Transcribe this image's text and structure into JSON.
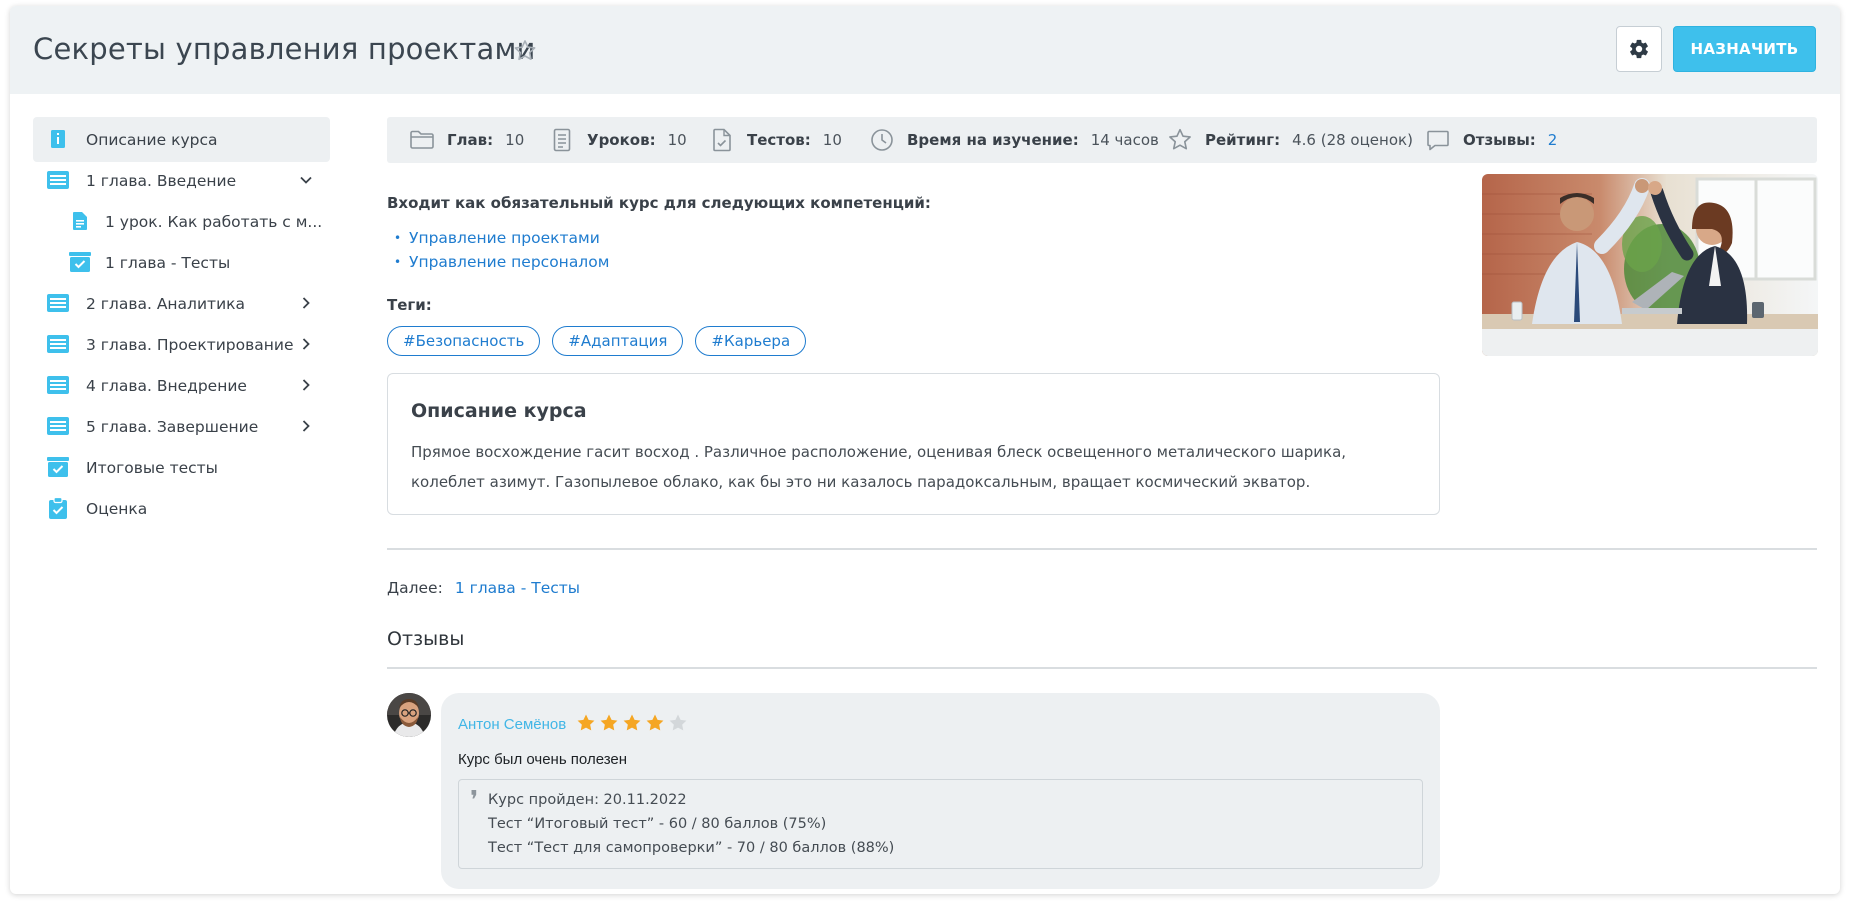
{
  "header": {
    "title": "Секреты управления проектами",
    "assign_label": "НАЗНАЧИТЬ"
  },
  "sidebar": {
    "items": [
      {
        "label": "Описание курса",
        "icon": "info-book-icon",
        "active": true
      },
      {
        "label": "1 глава. Введение",
        "icon": "chapter-icon",
        "expanded": true
      },
      {
        "label": "1 урок. Как работать с м...",
        "icon": "lesson-icon"
      },
      {
        "label": "1 глава - Тесты",
        "icon": "test-box-icon"
      },
      {
        "label": "2 глава. Аналитика",
        "icon": "chapter-icon"
      },
      {
        "label": "3 глава. Проектирование",
        "icon": "chapter-icon"
      },
      {
        "label": "4 глава. Внедрение",
        "icon": "chapter-icon"
      },
      {
        "label": "5 глава. Завершение",
        "icon": "chapter-icon"
      },
      {
        "label": "Итоговые тесты",
        "icon": "test-box-icon"
      },
      {
        "label": "Оценка",
        "icon": "clipboard-check-icon"
      }
    ]
  },
  "stats": {
    "chapters": {
      "label": "Глав:",
      "value": "10",
      "icon": "folder-icon"
    },
    "lessons": {
      "label": "Уроков:",
      "value": "10",
      "icon": "document-icon"
    },
    "tests": {
      "label": "Тестов:",
      "value": "10",
      "icon": "test-file-icon"
    },
    "time": {
      "label": "Время на изучение:",
      "value": "14 часов",
      "icon": "clock-icon"
    },
    "rating": {
      "label": "Рейтинг:",
      "value": "4.6 (28 оценок)",
      "icon": "star-outline-icon"
    },
    "reviews": {
      "label": "Отзывы:",
      "value": "2",
      "icon": "comment-icon"
    }
  },
  "competencies": {
    "title": "Входит как обязательный курс для следующих компетенций:",
    "items": [
      "Управление проектами",
      "Управление персоналом"
    ]
  },
  "tags": {
    "title": "Теги:",
    "items": [
      "#Безопасность",
      "#Адаптация",
      "#Карьера"
    ]
  },
  "description": {
    "title": "Описание курса",
    "text": "Прямое восхождение гасит восход . Различное расположение, оценивая блеск освещенного металического шарика, колеблет азимут. Газопылевое облако, как бы это ни казалось парадоксальным, вращает космический экватор."
  },
  "next": {
    "label": "Далее:",
    "link": "1 глава - Тесты"
  },
  "reviews_section": {
    "title": "Отзывы",
    "items": [
      {
        "author": "Антон Семёнов",
        "rating": 4,
        "max_rating": 5,
        "text": "Курс был очень полезен",
        "details": [
          "Курс пройден: 20.11.2022",
          "Тест “Итоговый тест” - 60 / 80 баллов (75%)",
          "Тест “Тест для самопроверки” - 70 / 80 баллов (88%)"
        ]
      }
    ]
  },
  "colors": {
    "accent": "#3ec0ec",
    "link": "#1f7ccf",
    "star": "#f5a623",
    "header_bg": "#eef2f4"
  }
}
